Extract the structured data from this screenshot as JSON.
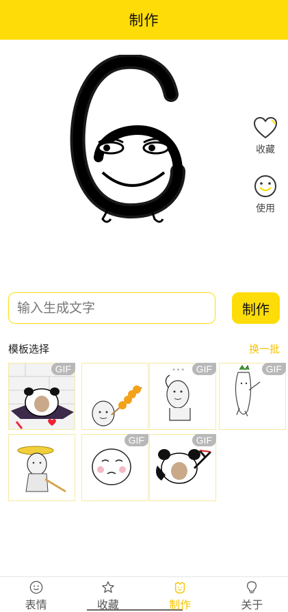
{
  "header": {
    "title": "制作"
  },
  "actions": {
    "favorite_label": "收藏",
    "use_label": "使用"
  },
  "input": {
    "placeholder": "输入生成文字",
    "value": ""
  },
  "make_button": {
    "label": "制作"
  },
  "templates": {
    "title": "模板选择",
    "refresh_label": "换一批",
    "gif_badge": "GIF",
    "items": [
      {
        "name": "panda-cape",
        "gif": true
      },
      {
        "name": "meme-skewer",
        "gif": false
      },
      {
        "name": "meme-hand-head",
        "gif": true
      },
      {
        "name": "radish-dancer",
        "gif": true
      },
      {
        "name": "straw-hat-man",
        "gif": false
      },
      {
        "name": "blush-face",
        "gif": true
      },
      {
        "name": "panda-slingshot",
        "gif": true
      }
    ]
  },
  "tabbar": {
    "tabs": [
      {
        "label": "表情",
        "icon": "smile-icon"
      },
      {
        "label": "收藏",
        "icon": "star-icon"
      },
      {
        "label": "制作",
        "icon": "make-icon"
      },
      {
        "label": "关于",
        "icon": "bulb-icon"
      }
    ],
    "active_index": 2
  },
  "colors": {
    "accent": "#FEDC07",
    "accent_text": "#F5C400"
  }
}
